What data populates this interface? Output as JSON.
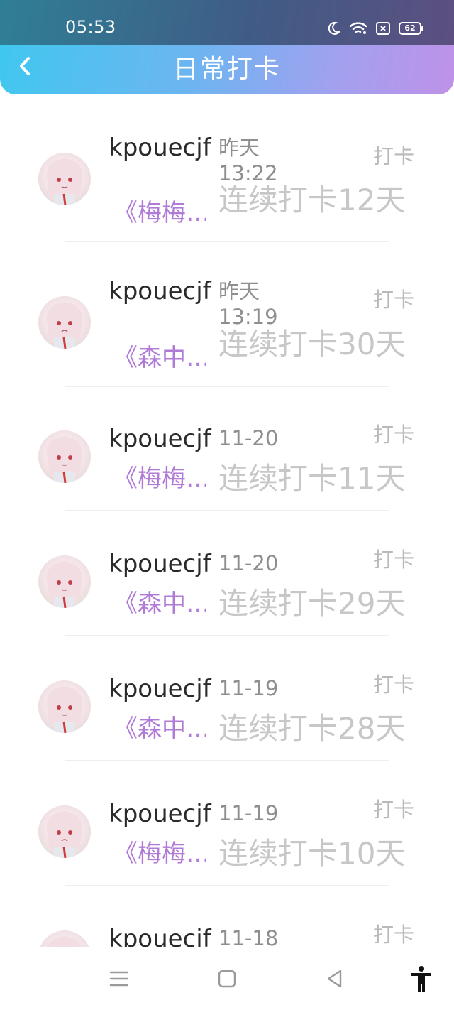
{
  "status_bar": {
    "time": "05:53",
    "battery": "62"
  },
  "header": {
    "title": "日常打卡"
  },
  "items": [
    {
      "username": "kpouecjf",
      "time_line1": "昨天",
      "time_line2": "13:22",
      "action": "打卡",
      "book": "《梅梅…",
      "streak": "连续打卡12天"
    },
    {
      "username": "kpouecjf",
      "time_line1": "昨天",
      "time_line2": "13:19",
      "action": "打卡",
      "book": "《森中…",
      "streak": "连续打卡30天"
    },
    {
      "username": "kpouecjf",
      "time_line1": "11-20",
      "time_line2": "",
      "action": "打卡",
      "book": "《梅梅…",
      "streak": "连续打卡11天"
    },
    {
      "username": "kpouecjf",
      "time_line1": "11-20",
      "time_line2": "",
      "action": "打卡",
      "book": "《森中…",
      "streak": "连续打卡29天"
    },
    {
      "username": "kpouecjf",
      "time_line1": "11-19",
      "time_line2": "",
      "action": "打卡",
      "book": "《森中…",
      "streak": "连续打卡28天"
    },
    {
      "username": "kpouecjf",
      "time_line1": "11-19",
      "time_line2": "",
      "action": "打卡",
      "book": "《梅梅…",
      "streak": "连续打卡10天"
    },
    {
      "username": "kpouecjf",
      "time_line1": "11-18",
      "time_line2": "",
      "action": "打卡",
      "book": "",
      "streak": ""
    }
  ],
  "icons": {
    "back": "chevron-left-icon",
    "moon": "moon-icon",
    "wifi": "wifi-icon",
    "sim": "sim-icon",
    "nav_menu": "menu-icon",
    "nav_home": "home-square-icon",
    "nav_back": "back-triangle-icon",
    "accessibility": "accessibility-icon"
  }
}
